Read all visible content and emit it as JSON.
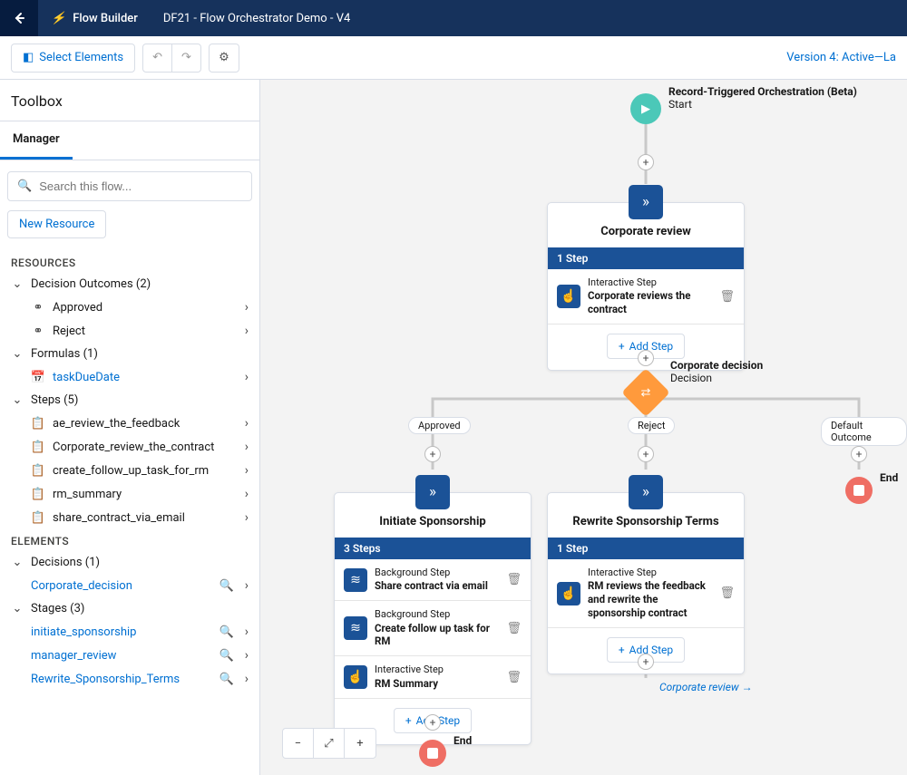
{
  "header": {
    "app": "Flow Builder",
    "title": "DF21 - Flow Orchestrator Demo - V4"
  },
  "toolbar": {
    "select_elements": "Select Elements",
    "status": "Version 4: Active—La"
  },
  "sidebar": {
    "title": "Toolbox",
    "tab": "Manager",
    "search_placeholder": "Search this flow...",
    "new_resource": "New Resource",
    "resources_hdr": "RESOURCES",
    "elements_hdr": "ELEMENTS",
    "groups": {
      "decision_outcomes": {
        "label": "Decision Outcomes (2)",
        "items": [
          "Approved",
          "Reject"
        ]
      },
      "formulas": {
        "label": "Formulas (1)",
        "items": [
          "taskDueDate"
        ]
      },
      "steps": {
        "label": "Steps (5)",
        "items": [
          "ae_review_the_feedback",
          "Corporate_review_the_contract",
          "create_follow_up_task_for_rm",
          "rm_summary",
          "share_contract_via_email"
        ]
      },
      "decisions": {
        "label": "Decisions (1)",
        "items": [
          "Corporate_decision"
        ]
      },
      "stages": {
        "label": "Stages (3)",
        "items": [
          "initiate_sponsorship",
          "manager_review",
          "Rewrite_Sponsorship_Terms"
        ]
      }
    }
  },
  "canvas": {
    "start": {
      "title": "Record-Triggered Orchestration (Beta)",
      "sub": "Start"
    },
    "decision": {
      "title": "Corporate decision",
      "sub": "Decision"
    },
    "pills": {
      "approved": "Approved",
      "reject": "Reject",
      "default": "Default Outcome"
    },
    "end_label": "End",
    "add_step": "Add Step",
    "goto": "Corporate review →",
    "stage1": {
      "title": "Corporate review",
      "count": "1 Step",
      "steps": [
        {
          "kind": "Interactive Step",
          "name": "Corporate reviews the contract",
          "icon": "tap"
        }
      ]
    },
    "stage2": {
      "title": "Initiate Sponsorship",
      "count": "3 Steps",
      "steps": [
        {
          "kind": "Background Step",
          "name": "Share contract via email",
          "icon": "flow"
        },
        {
          "kind": "Background Step",
          "name": "Create follow up task for RM",
          "icon": "flow"
        },
        {
          "kind": "Interactive Step",
          "name": "RM Summary",
          "icon": "tap"
        }
      ]
    },
    "stage3": {
      "title": "Rewrite Sponsorship Terms",
      "count": "1 Step",
      "steps": [
        {
          "kind": "Interactive Step",
          "name": "RM reviews the feedback and rewrite the sponsorship contract",
          "icon": "tap"
        }
      ]
    }
  }
}
